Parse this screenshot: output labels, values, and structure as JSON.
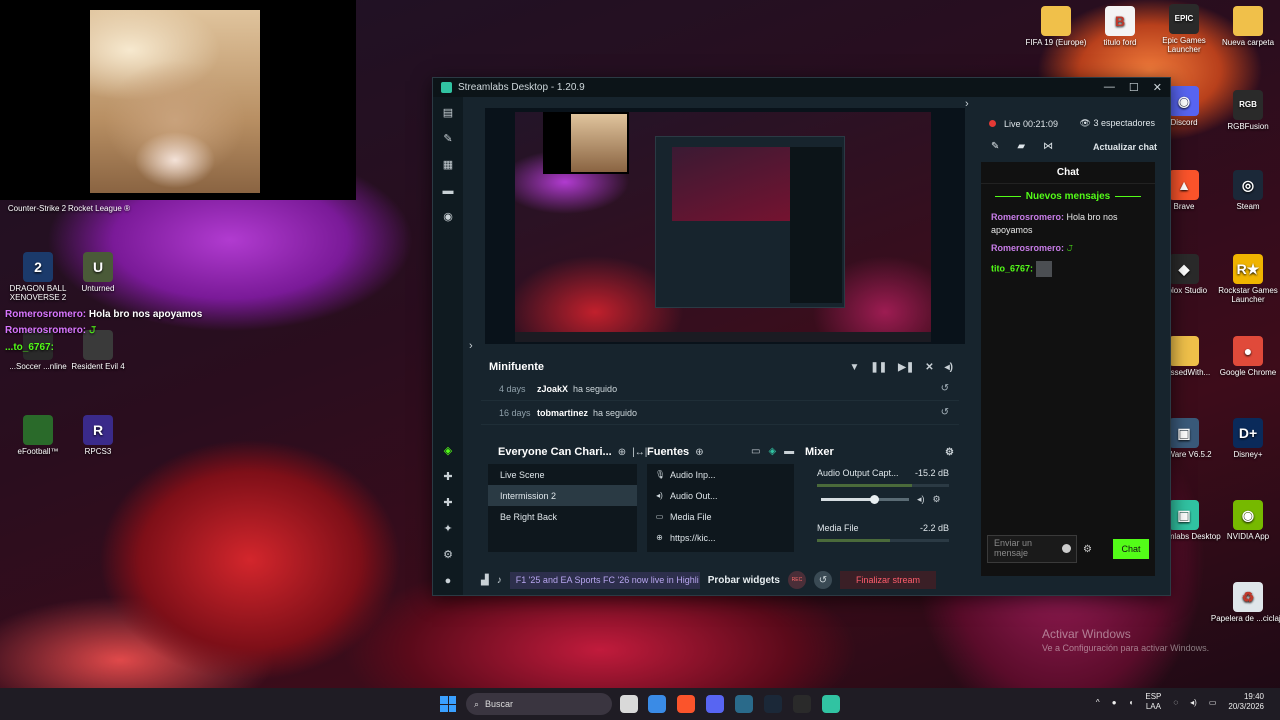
{
  "webcam": {
    "label": "webcam overlay"
  },
  "desktop_top_labels": [
    "Counter-Strike 2",
    "Rocket League ®"
  ],
  "desktop_icons_left": [
    {
      "label": "DRAGON BALL XENOVERSE 2",
      "icon": "dragonball-icon",
      "glyph": "2",
      "color": "#1b3a6b"
    },
    {
      "label": "Unturned",
      "icon": "unturned-icon",
      "glyph": "U",
      "color": "#4a5a38"
    },
    {
      "label": "...Soccer ...nline",
      "icon": "soccer-icon",
      "glyph": "",
      "color": "#2a2a2a"
    },
    {
      "label": "Resident Evil 4",
      "icon": "re4-icon",
      "glyph": "",
      "color": "#3a3a3a"
    },
    {
      "label": "eFootball™",
      "icon": "efootball-icon",
      "glyph": "",
      "color": "#2a6a2a"
    },
    {
      "label": "RPCS3",
      "icon": "rpcs3-icon",
      "glyph": "R",
      "color": "#3a2a8a"
    }
  ],
  "desktop_icons_right": [
    {
      "label": "FIFA 19 (Europe)",
      "icon": "folder-icon",
      "glyph": "",
      "color": "#f0c04a"
    },
    {
      "label": "titulo ford",
      "icon": "pdf-icon",
      "glyph": "B",
      "color": "#f4f4f4"
    },
    {
      "label": "Epic Games Launcher",
      "icon": "epic-games-icon",
      "glyph": "EPIC",
      "color": "#2a2a2a"
    },
    {
      "label": "Nueva carpeta",
      "icon": "folder-icon",
      "glyph": "",
      "color": "#f0c04a"
    },
    {
      "label": "Discord",
      "icon": "discord-icon",
      "glyph": "◉",
      "color": "#5865f2"
    },
    {
      "label": "RGBFusion",
      "icon": "rgbfusion-icon",
      "glyph": "RGB",
      "color": "#2a2a2a"
    },
    {
      "label": "Brave",
      "icon": "brave-icon",
      "glyph": "▲",
      "color": "#fb542b"
    },
    {
      "label": "Steam",
      "icon": "steam-icon",
      "glyph": "◎",
      "color": "#1b2838"
    },
    {
      "label": "...blox Studio",
      "icon": "roblox-icon",
      "glyph": "◆",
      "color": "#2a2a2a"
    },
    {
      "label": "Rockstar Games Launcher",
      "icon": "rockstar-icon",
      "glyph": "R★",
      "color": "#f0b400"
    },
    {
      "label": "...GssedWith...",
      "icon": "folder-icon",
      "glyph": "",
      "color": "#f0c04a"
    },
    {
      "label": "Google Chrome",
      "icon": "chrome-icon",
      "glyph": "●",
      "color": "#e04a3a"
    },
    {
      "label": "...eWare V6.5.2",
      "icon": "eware-icon",
      "glyph": "▣",
      "color": "#3a5a7a"
    },
    {
      "label": "Disney+",
      "icon": "disney-icon",
      "glyph": "D+",
      "color": "#0a2a5a"
    },
    {
      "label": "...treamlabs Desktop",
      "icon": "streamlabs-icon",
      "glyph": "▣",
      "color": "#31c3a2"
    },
    {
      "label": "NVIDIA App",
      "icon": "nvidia-icon",
      "glyph": "◉",
      "color": "#76b900"
    },
    {
      "label": "Papelera de ...ciclaje",
      "icon": "recycle-bin-icon",
      "glyph": "♻",
      "color": "#dfe6ea"
    }
  ],
  "overlay_chat": {
    "line1_user": "Romerosromero:",
    "line1_msg": "Hola bro nos apoyamos",
    "line2_user": "Romerosromero:",
    "line2_msg": "𝙹",
    "line3_user": "...to_6767:"
  },
  "app": {
    "title": "Streamlabs Desktop - 1.20.9",
    "window_controls": [
      "—",
      "☐",
      "✕"
    ],
    "nav_icons": [
      "editor-icon",
      "themes-icon",
      "store-icon",
      "layout-icon",
      "alerts-icon"
    ],
    "nav_bottom_icons": [
      "collectibles-icon",
      "stream-settings-icon",
      "studio-mode-icon",
      "effects-icon",
      "settings-icon",
      "profile-icon"
    ]
  },
  "minifeed": {
    "title": "Minifuente",
    "events": [
      {
        "age": "4 days",
        "user": "zJoakX",
        "action": "ha seguido"
      },
      {
        "age": "16 days",
        "user": "tobmartinez",
        "action": "ha seguido"
      }
    ]
  },
  "scenes": {
    "title": "Everyone Can Chari...",
    "items": [
      "Live Scene",
      "Intermission 2",
      "Be Right Back"
    ],
    "active_index": 1
  },
  "sources": {
    "title": "Fuentes",
    "items": [
      {
        "label": "Audio Inp...",
        "icon": "microphone-icon"
      },
      {
        "label": "Audio Out...",
        "icon": "speaker-icon"
      },
      {
        "label": "Media File",
        "icon": "media-file-icon"
      },
      {
        "label": "https://kic...",
        "icon": "globe-icon"
      }
    ]
  },
  "mixer": {
    "title": "Mixer",
    "channels": [
      {
        "name": "Audio Output Capt...",
        "db": "-15.2 dB",
        "meter_level": 0.72,
        "fader_level": 0.6
      },
      {
        "name": "Media File",
        "db": "-2.2 dB",
        "meter_level": 0.55,
        "fader_level": 0.8
      }
    ]
  },
  "footer": {
    "ticker": "F1 '25 and EA Sports FC '26 now live in Highli",
    "test_widgets": "Probar widgets",
    "rec": "REC",
    "end_stream": "Finalizar stream"
  },
  "live": {
    "status": "Live 00:21:09",
    "viewers": "3 espectadores",
    "refresh_chat": "Actualizar chat"
  },
  "chat": {
    "title": "Chat",
    "new_messages": "Nuevos mensajes",
    "messages": [
      {
        "user": "Romerosromero:",
        "text": "Hola bro nos apoyamos",
        "color": "#c87de8"
      },
      {
        "user": "Romerosromero:",
        "text": "𝙹",
        "color": "#c87de8"
      },
      {
        "user": "tito_6767:",
        "text": "",
        "color": "#53fc18"
      }
    ],
    "input_placeholder": "Enviar un mensaje",
    "send": "Chat"
  },
  "taskbar": {
    "search": "Buscar",
    "lang1": "ESP",
    "lang2": "LAA",
    "time": "19:40",
    "date": "20/3/2026"
  },
  "activate_windows": {
    "title": "Activar Windows",
    "subtitle": "Ve a Configuración para activar Windows."
  }
}
